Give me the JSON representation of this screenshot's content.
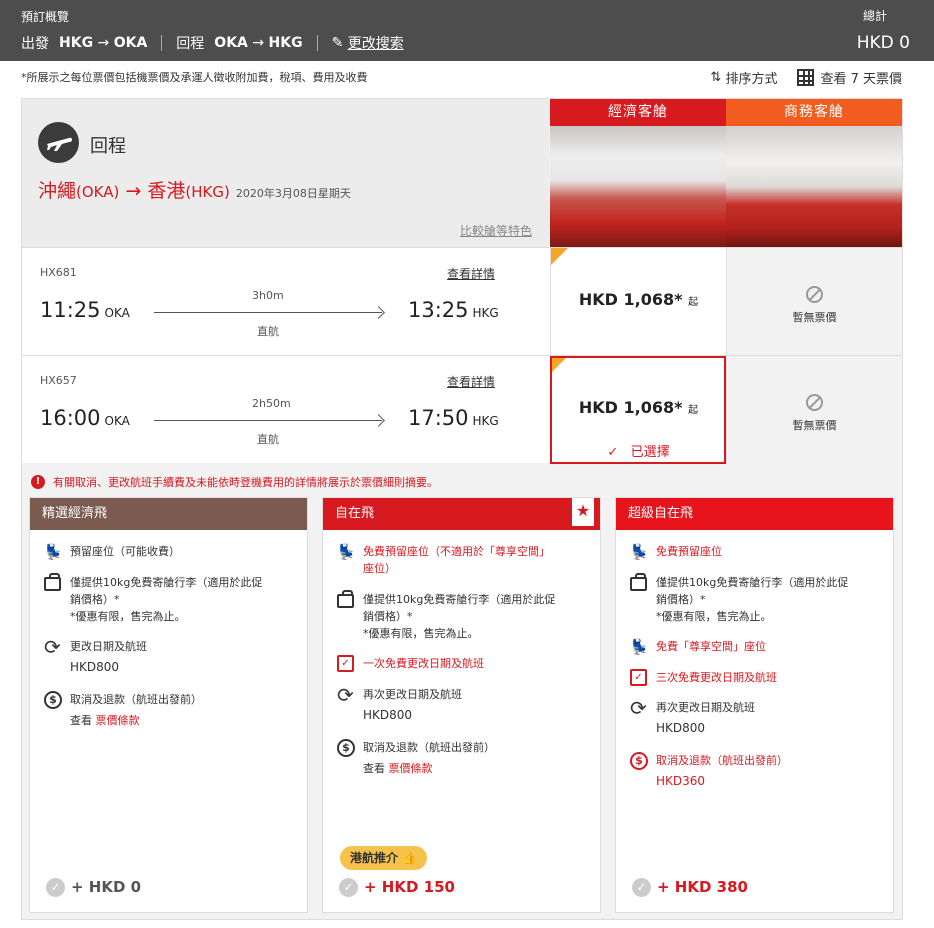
{
  "header": {
    "title": "預訂概覽",
    "depart_label": "出發",
    "depart_from": "HKG",
    "depart_to": "OKA",
    "return_label": "回程",
    "return_from": "OKA",
    "return_to": "HKG",
    "edit_label": "更改搜索",
    "total_label": "總計",
    "total_amount": "HKD 0"
  },
  "note": "*所展示之每位票價包括機票價及承運人徵收附加費，稅項、費用及收費",
  "toolbar": {
    "sort_label": "排序方式",
    "week_label": "查看 7 天票價"
  },
  "journey": {
    "title": "回程",
    "origin_city": "沖繩",
    "origin_code": "(OKA)",
    "dest_city": "香港",
    "dest_code": "(HKG)",
    "date": "2020年3月08日星期天",
    "compare_label": "比較艙等特色"
  },
  "cabins": {
    "economy": "經濟客艙",
    "business": "商務客艙"
  },
  "flights": [
    {
      "number": "HX681",
      "details": "查看詳情",
      "dep_time": "11:25",
      "dep_code": "OKA",
      "duration": "3h0m",
      "direct": "直航",
      "arr_time": "13:25",
      "arr_code": "HKG",
      "price": "HKD 1,068*",
      "price_suffix": "起",
      "business": "暫無票價"
    },
    {
      "number": "HX657",
      "details": "查看詳情",
      "dep_time": "16:00",
      "dep_code": "OKA",
      "duration": "2h50m",
      "direct": "直航",
      "arr_time": "17:50",
      "arr_code": "HKG",
      "price": "HKD 1,068*",
      "price_suffix": "起",
      "business": "暫無票價",
      "selected_label": "已選擇"
    }
  ],
  "warning": "有關取消、更改航班手續費及未能依時登機費用的詳情將展示於票價細則摘要。",
  "fares": [
    {
      "name": "精選經濟飛",
      "color": "#7b5a4f",
      "seat": "預留座位（可能收費）",
      "bag": "僅提供10kg免費寄艙行李（適用於此促\n銷價格）*",
      "bag_note": "*優惠有限，售完為止。",
      "change": "更改日期及航班",
      "change_fee": "HKD800",
      "refund": "取消及退款（航班出發前）",
      "terms_prefix": "查看",
      "terms_link": "票價條款",
      "add": "+ HKD 0"
    },
    {
      "name": "自在飛",
      "color": "#d71920",
      "seat": "免費預留座位（不適用於「尊享空間」\n座位）",
      "bag": "僅提供10kg免費寄艙行李（適用於此促\n銷價格）*",
      "bag_note": "*優惠有限，售完為止。",
      "free_change": "一次免費更改日期及航班",
      "change": "再次更改日期及航班",
      "change_fee": "HKD800",
      "refund": "取消及退款（航班出發前）",
      "terms_prefix": "查看",
      "terms_link": "票價條款",
      "badge": "港航推介",
      "add": "+ HKD 150"
    },
    {
      "name": "超級自在飛",
      "color": "#e8141c",
      "seat": "免費預留座位",
      "bag": "僅提供10kg免費寄艙行李（適用於此促\n銷價格）*",
      "bag_note": "*優惠有限，售完為止。",
      "premium_seat": "免費「尊享空間」座位",
      "free_change": "三次免費更改日期及航班",
      "change": "再次更改日期及航班",
      "change_fee": "HKD800",
      "refund": "取消及退款（航班出發前）",
      "refund_fee": "HKD360",
      "add": "+ HKD 380"
    }
  ]
}
